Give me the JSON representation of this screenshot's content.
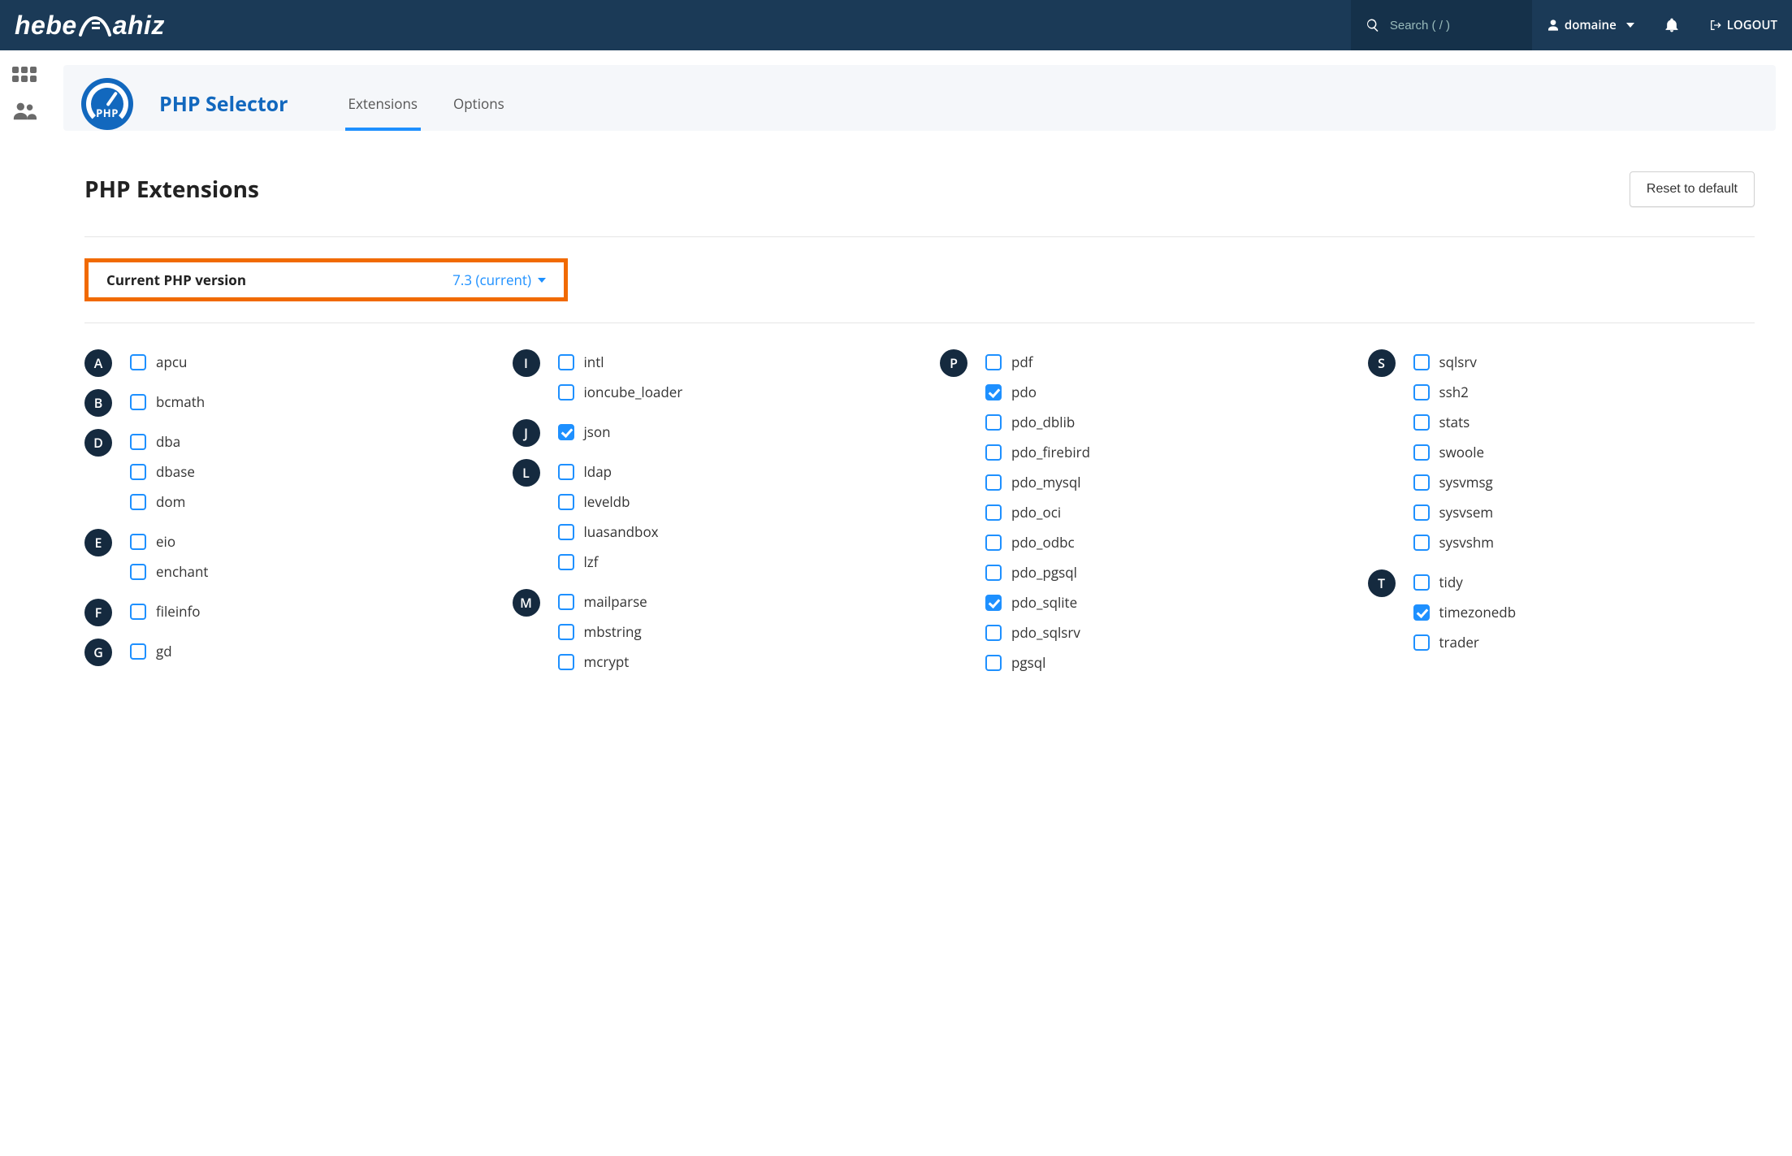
{
  "topbar": {
    "search_placeholder": "Search ( / )",
    "account_label": "domaine",
    "logout_label": "LOGOUT",
    "logo_text_a": "hebe",
    "logo_text_b": "ahiz"
  },
  "header": {
    "title": "PHP Selector",
    "badge_text": "PHP",
    "tabs": {
      "extensions": "Extensions",
      "options": "Options"
    }
  },
  "section": {
    "title": "PHP Extensions",
    "reset_label": "Reset to default",
    "version_label": "Current PHP version",
    "version_value": "7.3 (current)"
  },
  "columns": [
    [
      {
        "letter": "A",
        "items": [
          {
            "name": "apcu",
            "checked": false
          }
        ]
      },
      {
        "letter": "B",
        "items": [
          {
            "name": "bcmath",
            "checked": false
          }
        ]
      },
      {
        "letter": "D",
        "items": [
          {
            "name": "dba",
            "checked": false
          },
          {
            "name": "dbase",
            "checked": false
          },
          {
            "name": "dom",
            "checked": false
          }
        ]
      },
      {
        "letter": "E",
        "items": [
          {
            "name": "eio",
            "checked": false
          },
          {
            "name": "enchant",
            "checked": false
          }
        ]
      },
      {
        "letter": "F",
        "items": [
          {
            "name": "fileinfo",
            "checked": false
          }
        ]
      },
      {
        "letter": "G",
        "items": [
          {
            "name": "gd",
            "checked": false
          }
        ]
      }
    ],
    [
      {
        "letter": "I",
        "items": [
          {
            "name": "intl",
            "checked": false
          },
          {
            "name": "ioncube_loader",
            "checked": false
          }
        ]
      },
      {
        "letter": "J",
        "items": [
          {
            "name": "json",
            "checked": true
          }
        ]
      },
      {
        "letter": "L",
        "items": [
          {
            "name": "ldap",
            "checked": false
          },
          {
            "name": "leveldb",
            "checked": false
          },
          {
            "name": "luasandbox",
            "checked": false
          },
          {
            "name": "lzf",
            "checked": false
          }
        ]
      },
      {
        "letter": "M",
        "items": [
          {
            "name": "mailparse",
            "checked": false
          },
          {
            "name": "mbstring",
            "checked": false
          },
          {
            "name": "mcrypt",
            "checked": false
          }
        ]
      }
    ],
    [
      {
        "letter": "P",
        "items": [
          {
            "name": "pdf",
            "checked": false
          },
          {
            "name": "pdo",
            "checked": true
          },
          {
            "name": "pdo_dblib",
            "checked": false
          },
          {
            "name": "pdo_firebird",
            "checked": false
          },
          {
            "name": "pdo_mysql",
            "checked": false
          },
          {
            "name": "pdo_oci",
            "checked": false
          },
          {
            "name": "pdo_odbc",
            "checked": false
          },
          {
            "name": "pdo_pgsql",
            "checked": false
          },
          {
            "name": "pdo_sqlite",
            "checked": true
          },
          {
            "name": "pdo_sqlsrv",
            "checked": false
          },
          {
            "name": "pgsql",
            "checked": false
          }
        ]
      }
    ],
    [
      {
        "letter": "S",
        "items": [
          {
            "name": "sqlsrv",
            "checked": false
          },
          {
            "name": "ssh2",
            "checked": false
          },
          {
            "name": "stats",
            "checked": false
          },
          {
            "name": "swoole",
            "checked": false
          },
          {
            "name": "sysvmsg",
            "checked": false
          },
          {
            "name": "sysvsem",
            "checked": false
          },
          {
            "name": "sysvshm",
            "checked": false
          }
        ]
      },
      {
        "letter": "T",
        "items": [
          {
            "name": "tidy",
            "checked": false
          },
          {
            "name": "timezonedb",
            "checked": true
          },
          {
            "name": "trader",
            "checked": false
          }
        ]
      }
    ]
  ]
}
